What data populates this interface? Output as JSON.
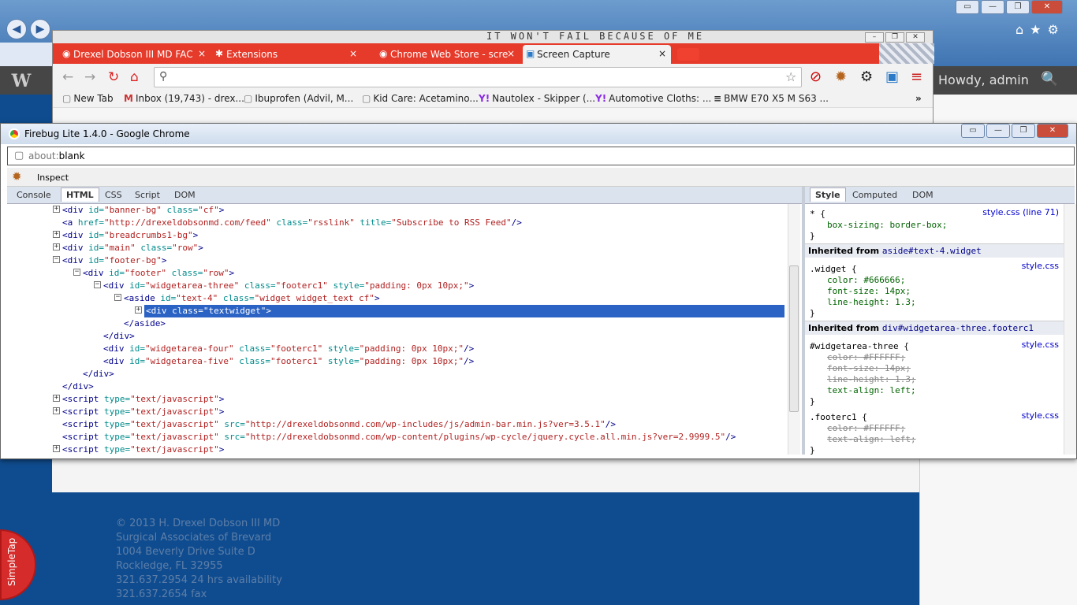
{
  "ie": {
    "back_glyph": "◀",
    "forward_glyph": "▶",
    "caption": {
      "min": "▭",
      "restore": "—",
      "max": "❐",
      "close": "✕"
    },
    "right_icons": {
      "home": "⌂",
      "fav": "★",
      "tools": "⚙"
    }
  },
  "wp": {
    "logo": "W",
    "howdy": "Howdy, admin",
    "search_glyph": "🔍"
  },
  "chrome": {
    "handwriting": "IT WON'T FAIL BECAUSE OF ME",
    "tabs": [
      {
        "label": "Drexel Dobson III MD FAC",
        "close": "×"
      },
      {
        "label": "Extensions",
        "close": "×"
      },
      {
        "label": "Chrome Web Store - scre",
        "close": "×"
      },
      {
        "label": "Screen Capture",
        "close": "×"
      }
    ],
    "caption": {
      "min": "–",
      "restore": "❐",
      "close": "✕"
    },
    "omnibox_value": "",
    "bookmarks": [
      {
        "label": "New Tab",
        "icon": "▢"
      },
      {
        "label": "Inbox (19,743) - drex...",
        "icon": "M"
      },
      {
        "label": "Ibuprofen (Advil, M...",
        "icon": "▢"
      },
      {
        "label": "Kid Care: Acetamino...",
        "icon": "▢"
      },
      {
        "label": "Nautolex - Skipper (...",
        "icon": "Y!"
      },
      {
        "label": "Automotive Cloths: ...",
        "icon": "Y!"
      },
      {
        "label": "BMW E70 X5 M S63 ...",
        "icon": "≡"
      }
    ],
    "bookmarks_more": "»"
  },
  "firebug": {
    "title": "Firebug Lite 1.4.0 - Google Chrome",
    "url_prefix": "about:",
    "url_rest": "blank",
    "inspect": "Inspect",
    "panel_tabs": [
      "Console",
      "HTML",
      "CSS",
      "Script",
      "DOM"
    ],
    "side_tabs": [
      "Style",
      "Computed",
      "DOM"
    ],
    "html_lines": [
      {
        "indent": 0,
        "tw": "+",
        "html": "<span class=\"tg\">&lt;div</span> <span class=\"at\">id=</span><span class=\"av\">\"banner-bg\"</span> <span class=\"at\">class=</span><span class=\"av\">\"cf\"</span><span class=\"tg\">&gt;</span>"
      },
      {
        "indent": 0,
        "tw": "",
        "html": "<span class=\"tg\">&lt;a</span> <span class=\"at\">href=</span><span class=\"av\">\"http://drexeldobsonmd.com/feed\"</span> <span class=\"at\">class=</span><span class=\"av\">\"rsslink\"</span> <span class=\"at\">title=</span><span class=\"av\">\"Subscribe to RSS Feed\"</span><span class=\"tg\">/&gt;</span>"
      },
      {
        "indent": 0,
        "tw": "+",
        "html": "<span class=\"tg\">&lt;div</span> <span class=\"at\">id=</span><span class=\"av\">\"breadcrumbs1-bg\"</span><span class=\"tg\">&gt;</span>"
      },
      {
        "indent": 0,
        "tw": "+",
        "html": "<span class=\"tg\">&lt;div</span> <span class=\"at\">id=</span><span class=\"av\">\"main\"</span> <span class=\"at\">class=</span><span class=\"av\">\"row\"</span><span class=\"tg\">&gt;</span>"
      },
      {
        "indent": 0,
        "tw": "−",
        "html": "<span class=\"tg\">&lt;div</span> <span class=\"at\">id=</span><span class=\"av\">\"footer-bg\"</span><span class=\"tg\">&gt;</span>"
      },
      {
        "indent": 1,
        "tw": "−",
        "html": "<span class=\"tg\">&lt;div</span> <span class=\"at\">id=</span><span class=\"av\">\"footer\"</span> <span class=\"at\">class=</span><span class=\"av\">\"row\"</span><span class=\"tg\">&gt;</span>"
      },
      {
        "indent": 2,
        "tw": "−",
        "html": "<span class=\"tg\">&lt;div</span> <span class=\"at\">id=</span><span class=\"av\">\"widgetarea-three\"</span> <span class=\"at\">class=</span><span class=\"av\">\"footerc1\"</span> <span class=\"at\">style=</span><span class=\"av\">\"padding: 0px 10px;\"</span><span class=\"tg\">&gt;</span>"
      },
      {
        "indent": 3,
        "tw": "−",
        "html": "<span class=\"tg\">&lt;aside</span> <span class=\"at\">id=</span><span class=\"av\">\"text-4\"</span> <span class=\"at\">class=</span><span class=\"av\">\"widget widget_text cf\"</span><span class=\"tg\">&gt;</span>"
      },
      {
        "indent": 4,
        "tw": "+",
        "sel": true,
        "html": "<span class=\"tg\">&lt;div</span> <span class=\"at\">class=</span><span class=\"av\">\"textwidget\"</span><span class=\"tg\">&gt;</span>"
      },
      {
        "indent": 3,
        "tw": "",
        "html": "<span class=\"tg\">&lt;/aside&gt;</span>"
      },
      {
        "indent": 2,
        "tw": "",
        "html": "<span class=\"tg\">&lt;/div&gt;</span>"
      },
      {
        "indent": 2,
        "tw": "",
        "html": "<span class=\"tg\">&lt;div</span> <span class=\"at\">id=</span><span class=\"av\">\"widgetarea-four\"</span> <span class=\"at\">class=</span><span class=\"av\">\"footerc1\"</span> <span class=\"at\">style=</span><span class=\"av\">\"padding: 0px 10px;\"</span><span class=\"tg\">/&gt;</span>"
      },
      {
        "indent": 2,
        "tw": "",
        "html": "<span class=\"tg\">&lt;div</span> <span class=\"at\">id=</span><span class=\"av\">\"widgetarea-five\"</span> <span class=\"at\">class=</span><span class=\"av\">\"footerc1\"</span> <span class=\"at\">style=</span><span class=\"av\">\"padding: 0px 10px;\"</span><span class=\"tg\">/&gt;</span>"
      },
      {
        "indent": 1,
        "tw": "",
        "html": "<span class=\"tg\">&lt;/div&gt;</span>"
      },
      {
        "indent": 0,
        "tw": "",
        "html": "<span class=\"tg\">&lt;/div&gt;</span>"
      },
      {
        "indent": 0,
        "tw": "+",
        "html": "<span class=\"tg\">&lt;script</span> <span class=\"at\">type=</span><span class=\"av\">\"text/javascript\"</span><span class=\"tg\">&gt;</span>"
      },
      {
        "indent": 0,
        "tw": "+",
        "html": "<span class=\"tg\">&lt;script</span> <span class=\"at\">type=</span><span class=\"av\">\"text/javascript\"</span><span class=\"tg\">&gt;</span>"
      },
      {
        "indent": 0,
        "tw": "",
        "html": "<span class=\"tg\">&lt;script</span> <span class=\"at\">type=</span><span class=\"av\">\"text/javascript\"</span> <span class=\"at\">src=</span><span class=\"av\">\"http://drexeldobsonmd.com/wp-includes/js/admin-bar.min.js?ver=3.5.1\"</span><span class=\"tg\">/&gt;</span>"
      },
      {
        "indent": 0,
        "tw": "",
        "html": "<span class=\"tg\">&lt;script</span> <span class=\"at\">type=</span><span class=\"av\">\"text/javascript\"</span> <span class=\"at\">src=</span><span class=\"av\">\"http://drexeldobsonmd.com/wp-content/plugins/wp-cycle/jquery.cycle.all.min.js?ver=2.9999.5\"</span><span class=\"tg\">/&gt;</span>"
      },
      {
        "indent": 0,
        "tw": "+",
        "html": "<span class=\"tg\">&lt;script</span> <span class=\"at\">type=</span><span class=\"av\">\"text/javascript\"</span><span class=\"tg\">&gt;</span>"
      }
    ],
    "style": {
      "rule1_selector": "* {",
      "rule1_link": "style.css (line 71)",
      "rule1_prop": "box-sizing: border-box;",
      "close": "}",
      "inherited1_label": "Inherited from",
      "inherited1_target": "aside#text-4.widget",
      "rule2_selector": ".widget {",
      "rule2_link": "style.css",
      "rule2_props": [
        "color: #666666;",
        "font-size: 14px;",
        "line-height: 1.3;"
      ],
      "inherited2_label": "Inherited from",
      "inherited2_target": "div#widgetarea-three.footerc1",
      "rule3_selector": "#widgetarea-three {",
      "rule3_link": "style.css",
      "rule3_struck": [
        "color: #FFFFFF;",
        "font-size: 14px;",
        "line-height: 1.3;"
      ],
      "rule3_prop": "text-align: left;",
      "rule4_selector": ".footerc1 {",
      "rule4_link": "style.css",
      "rule4_struck": [
        "color: #FFFFFF;",
        "text-align: left;"
      ]
    }
  },
  "site_footer": [
    "© 2013 H. Drexel Dobson III MD",
    "Surgical Associates of Brevard",
    "1004 Beverly Drive Suite D",
    "Rockledge, FL 32955",
    "321.637.2954 24 hrs availability",
    "321.637.2654 fax"
  ],
  "simpletap": "SimpleTap"
}
